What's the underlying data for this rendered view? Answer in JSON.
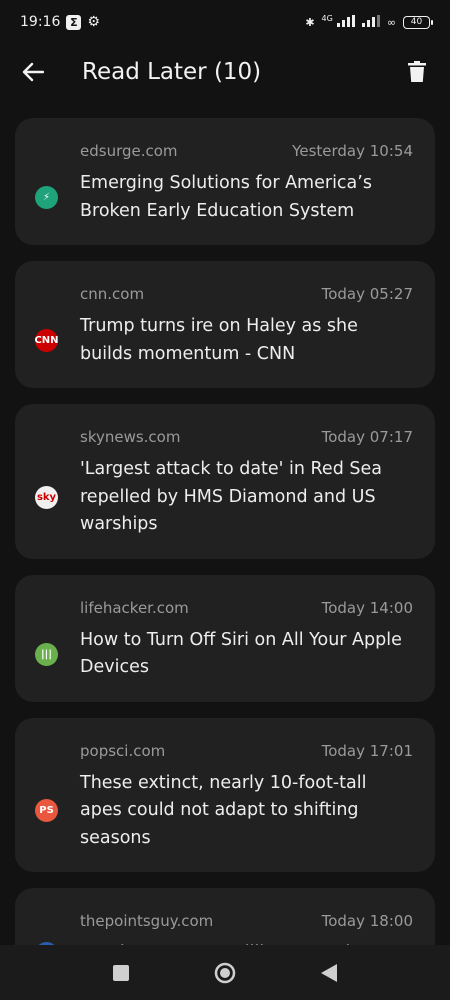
{
  "status_bar": {
    "time": "19:16",
    "network_type": "4G",
    "battery": "40"
  },
  "app_bar": {
    "title": "Read Later (10)"
  },
  "articles": [
    {
      "domain": "edsurge.com",
      "time": "Yesterday 10:54",
      "title": "Emerging Solutions for America’s Broken Early Education System",
      "favicon_color": "#1fa37a",
      "favicon_text": "⚡"
    },
    {
      "domain": "cnn.com",
      "time": "Today 05:27",
      "title": "Trump turns ire on Haley as she builds momentum - CNN",
      "favicon_color": "#cc0000",
      "favicon_text": "CNN"
    },
    {
      "domain": "skynews.com",
      "time": "Today 07:17",
      "title": "'Largest attack to date' in Red Sea repelled by HMS Diamond and US warships",
      "favicon_color": "#f0f0f0",
      "favicon_text": "sky"
    },
    {
      "domain": "lifehacker.com",
      "time": "Today 14:00",
      "title": "How to Turn Off Siri on All Your Apple Devices",
      "favicon_color": "#6ab04c",
      "favicon_text": "|||"
    },
    {
      "domain": "popsci.com",
      "time": "Today 17:01",
      "title": "These extinct, nearly 10-foot-tall apes could not adapt to shifting seasons",
      "favicon_color": "#e9573f",
      "favicon_text": "PS"
    },
    {
      "domain": "thepointsguy.com",
      "time": "Today 18:00",
      "title": "Marriott Bonvoy Brilliant American",
      "favicon_color": "#2a5db0",
      "favicon_text": ""
    }
  ]
}
